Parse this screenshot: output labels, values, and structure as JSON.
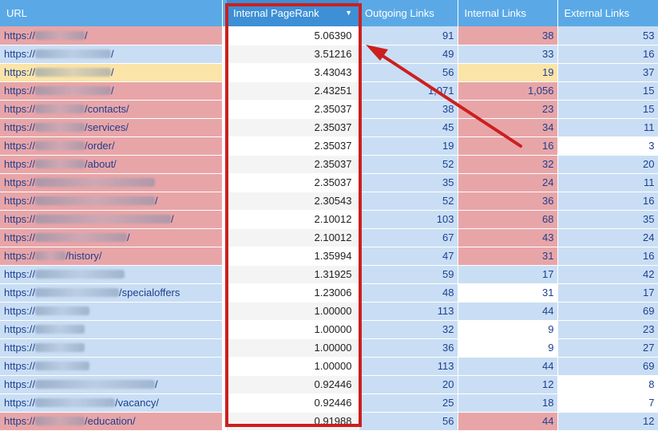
{
  "columns": {
    "url": "URL",
    "pagerank": "Internal PageRank",
    "outgoing": "Outgoing Links",
    "internal": "Internal Links",
    "external": "External Links"
  },
  "sort_icon": "sort-descending-icon",
  "colors": {
    "header": "#5aa9e6",
    "header_selected": "#3d8fd6",
    "red": "#e8a5a8",
    "blue": "#c9def4",
    "yellow": "#fbe4a8",
    "white": "#ffffff",
    "highlight_frame": "#cc1f1f",
    "link_text": "#1d3f8f"
  },
  "rows": [
    {
      "url_prefix": "https://",
      "url_suffix": "/",
      "pagerank": "5.06390",
      "outgoing": "91",
      "internal": "38",
      "external": "53",
      "url_color": "red",
      "out_color": "blue",
      "int_color": "red",
      "ext_color": "blue"
    },
    {
      "url_prefix": "https://",
      "url_suffix": "/",
      "pagerank": "3.51216",
      "outgoing": "49",
      "internal": "33",
      "external": "16",
      "url_color": "blue",
      "out_color": "blue",
      "int_color": "blue",
      "ext_color": "blue"
    },
    {
      "url_prefix": "https://",
      "url_suffix": "/",
      "pagerank": "3.43043",
      "outgoing": "56",
      "internal": "19",
      "external": "37",
      "url_color": "yellow",
      "out_color": "blue",
      "int_color": "yellow",
      "ext_color": "blue"
    },
    {
      "url_prefix": "https://",
      "url_suffix": "/",
      "pagerank": "2.43251",
      "outgoing": "1,071",
      "internal": "1,056",
      "external": "15",
      "url_color": "red",
      "out_color": "blue",
      "int_color": "red",
      "ext_color": "blue"
    },
    {
      "url_prefix": "https://",
      "url_suffix": "/contacts/",
      "pagerank": "2.35037",
      "outgoing": "38",
      "internal": "23",
      "external": "15",
      "url_color": "red",
      "out_color": "blue",
      "int_color": "red",
      "ext_color": "blue"
    },
    {
      "url_prefix": "https://",
      "url_suffix": "/services/",
      "pagerank": "2.35037",
      "outgoing": "45",
      "internal": "34",
      "external": "11",
      "url_color": "red",
      "out_color": "blue",
      "int_color": "red",
      "ext_color": "blue"
    },
    {
      "url_prefix": "https://",
      "url_suffix": "/order/",
      "pagerank": "2.35037",
      "outgoing": "19",
      "internal": "16",
      "external": "3",
      "url_color": "red",
      "out_color": "blue",
      "int_color": "red",
      "ext_color": "white"
    },
    {
      "url_prefix": "https://",
      "url_suffix": "/about/",
      "pagerank": "2.35037",
      "outgoing": "52",
      "internal": "32",
      "external": "20",
      "url_color": "red",
      "out_color": "blue",
      "int_color": "red",
      "ext_color": "blue"
    },
    {
      "url_prefix": "https://",
      "url_suffix": "",
      "pagerank": "2.35037",
      "outgoing": "35",
      "internal": "24",
      "external": "11",
      "url_color": "red",
      "out_color": "blue",
      "int_color": "red",
      "ext_color": "blue"
    },
    {
      "url_prefix": "https://",
      "url_suffix": "/",
      "pagerank": "2.30543",
      "outgoing": "52",
      "internal": "36",
      "external": "16",
      "url_color": "red",
      "out_color": "blue",
      "int_color": "red",
      "ext_color": "blue"
    },
    {
      "url_prefix": "https://",
      "url_suffix": "/",
      "pagerank": "2.10012",
      "outgoing": "103",
      "internal": "68",
      "external": "35",
      "url_color": "red",
      "out_color": "blue",
      "int_color": "red",
      "ext_color": "blue"
    },
    {
      "url_prefix": "https://",
      "url_suffix": "/",
      "pagerank": "2.10012",
      "outgoing": "67",
      "internal": "43",
      "external": "24",
      "url_color": "red",
      "out_color": "blue",
      "int_color": "red",
      "ext_color": "blue"
    },
    {
      "url_prefix": "https://",
      "url_suffix": "/history/",
      "pagerank": "1.35994",
      "outgoing": "47",
      "internal": "31",
      "external": "16",
      "url_color": "red",
      "out_color": "blue",
      "int_color": "red",
      "ext_color": "blue"
    },
    {
      "url_prefix": "https://",
      "url_suffix": "",
      "pagerank": "1.31925",
      "outgoing": "59",
      "internal": "17",
      "external": "42",
      "url_color": "blue",
      "out_color": "blue",
      "int_color": "blue",
      "ext_color": "blue"
    },
    {
      "url_prefix": "https://",
      "url_suffix": "/specialoffers",
      "pagerank": "1.23006",
      "outgoing": "48",
      "internal": "31",
      "external": "17",
      "url_color": "blue",
      "out_color": "blue",
      "int_color": "white",
      "ext_color": "blue"
    },
    {
      "url_prefix": "https://",
      "url_suffix": "",
      "pagerank": "1.00000",
      "outgoing": "113",
      "internal": "44",
      "external": "69",
      "url_color": "blue",
      "out_color": "blue",
      "int_color": "blue",
      "ext_color": "blue"
    },
    {
      "url_prefix": "https://",
      "url_suffix": "",
      "pagerank": "1.00000",
      "outgoing": "32",
      "internal": "9",
      "external": "23",
      "url_color": "blue",
      "out_color": "blue",
      "int_color": "white",
      "ext_color": "blue"
    },
    {
      "url_prefix": "https://",
      "url_suffix": "",
      "pagerank": "1.00000",
      "outgoing": "36",
      "internal": "9",
      "external": "27",
      "url_color": "blue",
      "out_color": "blue",
      "int_color": "white",
      "ext_color": "blue"
    },
    {
      "url_prefix": "https://",
      "url_suffix": "",
      "pagerank": "1.00000",
      "outgoing": "113",
      "internal": "44",
      "external": "69",
      "url_color": "blue",
      "out_color": "blue",
      "int_color": "blue",
      "ext_color": "blue"
    },
    {
      "url_prefix": "https://",
      "url_suffix": "/",
      "pagerank": "0.92446",
      "outgoing": "20",
      "internal": "12",
      "external": "8",
      "url_color": "blue",
      "out_color": "blue",
      "int_color": "blue",
      "ext_color": "white"
    },
    {
      "url_prefix": "https://",
      "url_suffix": "/vacancy/",
      "pagerank": "0.92446",
      "outgoing": "25",
      "internal": "18",
      "external": "7",
      "url_color": "blue",
      "out_color": "blue",
      "int_color": "blue",
      "ext_color": "white"
    },
    {
      "url_prefix": "https://",
      "url_suffix": "/education/",
      "pagerank": "0.91988",
      "outgoing": "56",
      "internal": "44",
      "external": "12",
      "url_color": "red",
      "out_color": "blue",
      "int_color": "red",
      "ext_color": "blue"
    }
  ]
}
